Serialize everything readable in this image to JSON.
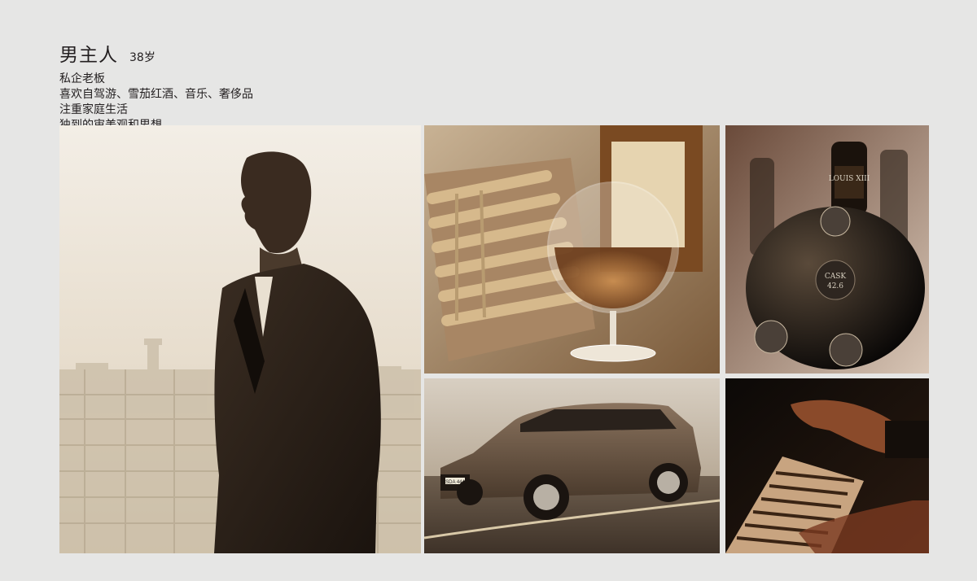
{
  "persona": {
    "title": "男主人",
    "age": "38岁",
    "traits": [
      "私企老板",
      "喜欢自驾游、雪茄红酒、音乐、奢侈品",
      "注重家庭生活",
      "独到的审美观和思想"
    ]
  },
  "images": {
    "portrait": "man-in-suit-city-skyline-photo",
    "cigars_brandy": "cigars-and-brandy-glass-photo",
    "cognac": "cognac-decanter-photo",
    "car": "volvo-suv-photo",
    "piano": "hand-on-piano-photo"
  },
  "labels": {
    "cognac_neck": "LOUIS XIII",
    "cognac_cask": "CASK",
    "cognac_cask_number": "42.6",
    "plate": "SDA 444"
  },
  "colors": {
    "background": "#e6e6e5",
    "text": "#231f20",
    "sepia_light": "#e9e0d1",
    "sepia_dark": "#2a1f18"
  }
}
